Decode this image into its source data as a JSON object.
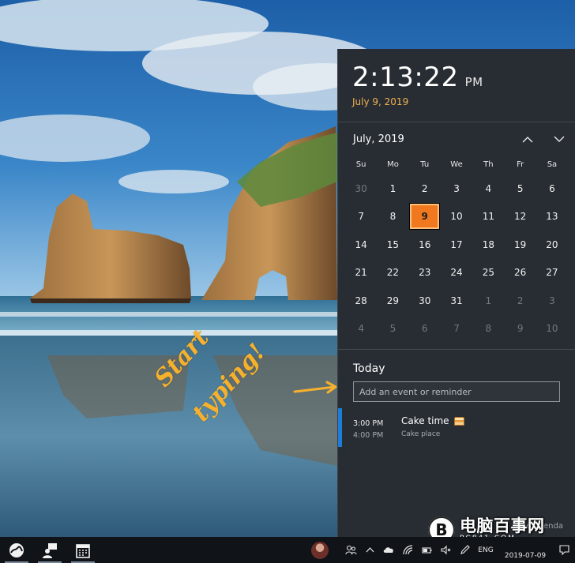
{
  "flyout": {
    "time": "2:13:22",
    "ampm": "PM",
    "long_date": "July 9, 2019",
    "month_label": "July, 2019",
    "weekdays": [
      "Su",
      "Mo",
      "Tu",
      "We",
      "Th",
      "Fr",
      "Sa"
    ],
    "days": [
      {
        "d": "30",
        "other": true
      },
      {
        "d": "1"
      },
      {
        "d": "2"
      },
      {
        "d": "3"
      },
      {
        "d": "4"
      },
      {
        "d": "5"
      },
      {
        "d": "6"
      },
      {
        "d": "7"
      },
      {
        "d": "8"
      },
      {
        "d": "9",
        "today": true
      },
      {
        "d": "10"
      },
      {
        "d": "11"
      },
      {
        "d": "12"
      },
      {
        "d": "13"
      },
      {
        "d": "14"
      },
      {
        "d": "15"
      },
      {
        "d": "16"
      },
      {
        "d": "17"
      },
      {
        "d": "18"
      },
      {
        "d": "19"
      },
      {
        "d": "20"
      },
      {
        "d": "21"
      },
      {
        "d": "22"
      },
      {
        "d": "23"
      },
      {
        "d": "24"
      },
      {
        "d": "25"
      },
      {
        "d": "26"
      },
      {
        "d": "27"
      },
      {
        "d": "28"
      },
      {
        "d": "29"
      },
      {
        "d": "30"
      },
      {
        "d": "31"
      },
      {
        "d": "1",
        "other": true
      },
      {
        "d": "2",
        "other": true
      },
      {
        "d": "3",
        "other": true
      },
      {
        "d": "4",
        "other": true
      },
      {
        "d": "5",
        "other": true
      },
      {
        "d": "6",
        "other": true
      },
      {
        "d": "7",
        "other": true
      },
      {
        "d": "8",
        "other": true
      },
      {
        "d": "9",
        "other": true
      },
      {
        "d": "10",
        "other": true
      }
    ],
    "agenda": {
      "title": "Today",
      "input_placeholder": "Add an event or reminder",
      "event": {
        "start": "3:00 PM",
        "end": "4:00 PM",
        "title": "Cake time",
        "location": "Cake place"
      },
      "hide_label": "Hide agenda"
    }
  },
  "ink": {
    "word1": "Start",
    "word2": "typing!"
  },
  "watermark": {
    "logo_letter": "B",
    "main": "电脑百事网",
    "sub": "PC841.COM"
  },
  "taskbar": {
    "apps": [
      "whiteboard-icon",
      "people-share-icon",
      "calendar-icon"
    ],
    "language": "ENG",
    "date": "2019-07-09"
  },
  "colors": {
    "accent": "#f0781e",
    "event_bar": "#1c7ed8",
    "ink": "#f5b12e",
    "panel": "#282d33"
  }
}
